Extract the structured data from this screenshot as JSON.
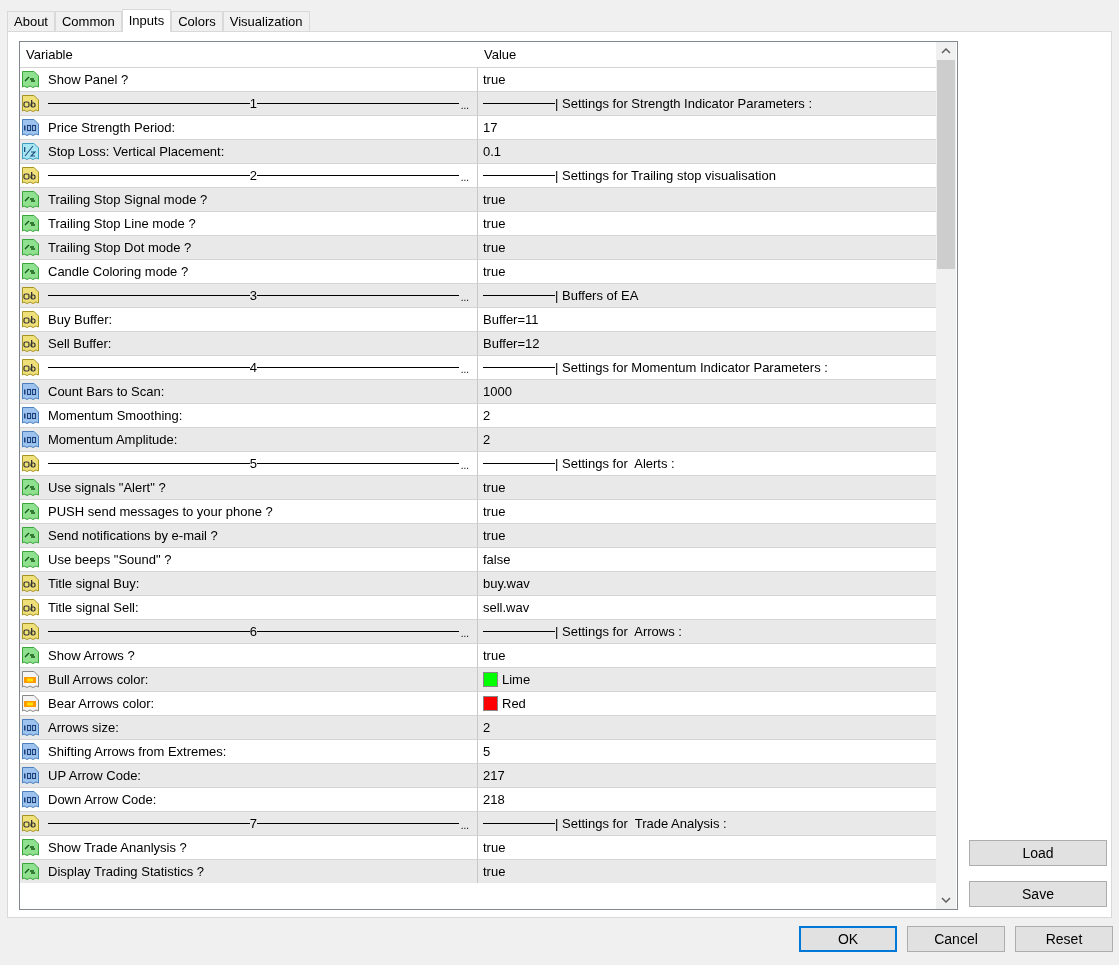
{
  "tabs": [
    {
      "label": "About",
      "selected": false
    },
    {
      "label": "Common",
      "selected": false
    },
    {
      "label": "Inputs",
      "selected": true
    },
    {
      "label": "Colors",
      "selected": false
    },
    {
      "label": "Visualization",
      "selected": false
    }
  ],
  "table": {
    "columns": [
      "Variable",
      "Value"
    ],
    "rows": [
      {
        "kind": "bool",
        "variable": "Show Panel ?",
        "value": "true"
      },
      {
        "kind": "separator",
        "variable": "1",
        "ellipsis": "...",
        "value": "| Settings for Strength Indicator Parameters :"
      },
      {
        "kind": "int",
        "variable": "Price Strength Period:",
        "value": "17"
      },
      {
        "kind": "double",
        "variable": "Stop Loss: Vertical Placement:",
        "value": "0.1"
      },
      {
        "kind": "separator",
        "variable": "2",
        "ellipsis": "...",
        "value": "| Settings for Trailing stop visualisation"
      },
      {
        "kind": "bool",
        "variable": "Trailing Stop Signal mode ?",
        "value": "true"
      },
      {
        "kind": "bool",
        "variable": "Trailing Stop Line mode ?",
        "value": "true"
      },
      {
        "kind": "bool",
        "variable": "Trailing Stop Dot mode ?",
        "value": "true"
      },
      {
        "kind": "bool",
        "variable": "Candle Coloring mode ?",
        "value": "true"
      },
      {
        "kind": "separator",
        "variable": "3",
        "ellipsis": "...",
        "value": "| Buffers of EA"
      },
      {
        "kind": "string",
        "variable": "Buy Buffer:",
        "value": "Buffer=11"
      },
      {
        "kind": "string",
        "variable": "Sell Buffer:",
        "value": "Buffer=12"
      },
      {
        "kind": "separator",
        "variable": "4",
        "ellipsis": "...",
        "value": "| Settings for Momentum Indicator Parameters :"
      },
      {
        "kind": "int",
        "variable": "Count Bars to Scan:",
        "value": "1000"
      },
      {
        "kind": "int",
        "variable": "Momentum Smoothing:",
        "value": "2"
      },
      {
        "kind": "int",
        "variable": "Momentum Amplitude:",
        "value": "2"
      },
      {
        "kind": "separator",
        "variable": "5",
        "ellipsis": "...",
        "value": "| Settings for  Alerts :"
      },
      {
        "kind": "bool",
        "variable": "Use signals \"Alert\" ?",
        "value": "true"
      },
      {
        "kind": "bool",
        "variable": "PUSH send messages to your phone ?",
        "value": "true"
      },
      {
        "kind": "bool",
        "variable": "Send notifications by e-mail ?",
        "value": "true"
      },
      {
        "kind": "bool",
        "variable": "Use beeps \"Sound\" ?",
        "value": "false"
      },
      {
        "kind": "string",
        "variable": "Title signal Buy:",
        "value": "buy.wav"
      },
      {
        "kind": "string",
        "variable": "Title signal Sell:",
        "value": "sell.wav"
      },
      {
        "kind": "separator",
        "variable": "6",
        "ellipsis": "...",
        "value": "| Settings for  Arrows :"
      },
      {
        "kind": "bool",
        "variable": "Show Arrows ?",
        "value": "true"
      },
      {
        "kind": "color",
        "variable": "Bull Arrows color:",
        "value": "Lime",
        "color": "#00ff00"
      },
      {
        "kind": "color",
        "variable": "Bear Arrows color:",
        "value": "Red",
        "color": "#ff0000"
      },
      {
        "kind": "int",
        "variable": "Arrows size:",
        "value": "2"
      },
      {
        "kind": "int",
        "variable": "Shifting Arrows from Extremes:",
        "value": "5"
      },
      {
        "kind": "int",
        "variable": "UP Arrow Code:",
        "value": "217"
      },
      {
        "kind": "int",
        "variable": "Down Arrow Code:",
        "value": "218"
      },
      {
        "kind": "separator",
        "variable": "7",
        "ellipsis": "...",
        "value": "| Settings for  Trade Analysis :"
      },
      {
        "kind": "bool",
        "variable": "Show Trade Ananlysis ?",
        "value": "true"
      },
      {
        "kind": "bool",
        "variable": "Display Trading Statistics ?",
        "value": "true"
      }
    ]
  },
  "side_buttons": [
    "Load",
    "Save"
  ],
  "buttons": [
    {
      "label": "OK",
      "default": true
    },
    {
      "label": "Cancel",
      "default": false
    },
    {
      "label": "Reset",
      "default": false
    }
  ]
}
